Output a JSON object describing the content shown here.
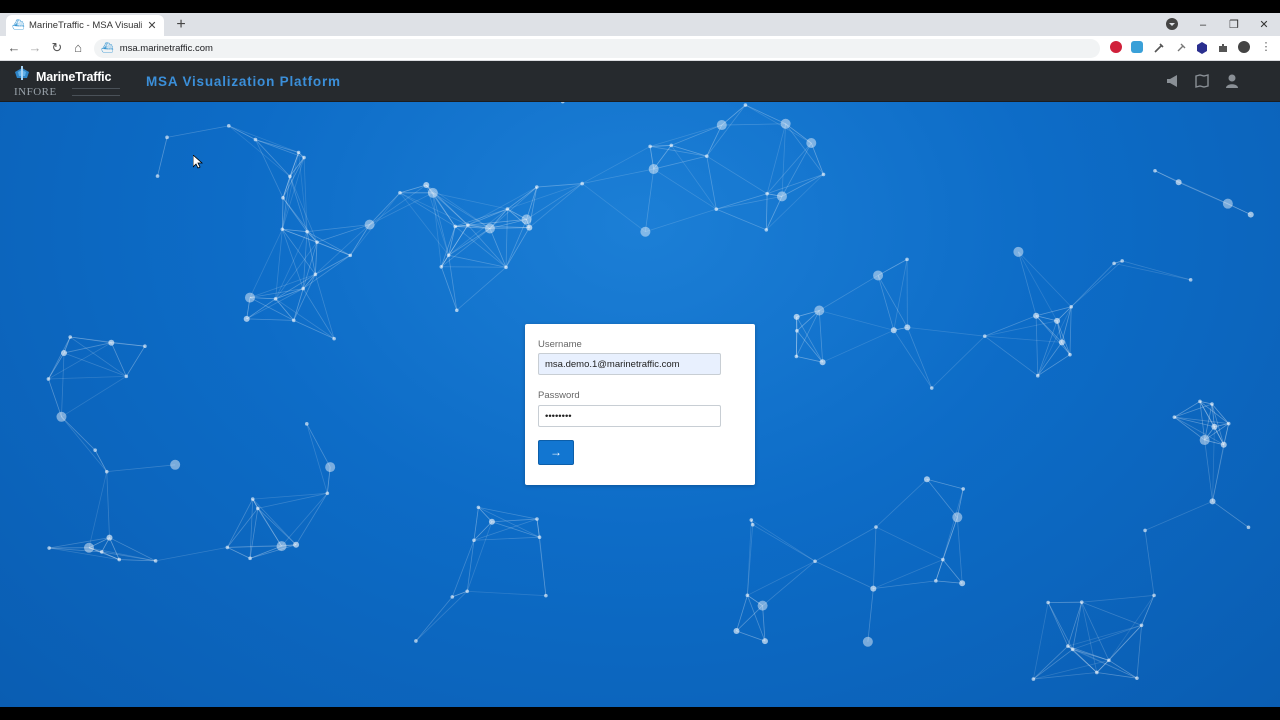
{
  "browser": {
    "tab": {
      "title": "MarineTraffic - MSA Visualization",
      "favicon": "marinetraffic-favicon"
    },
    "new_tab_label": "+",
    "nav": {
      "back": "←",
      "forward": "→",
      "reload": "↻",
      "home": "⌂"
    },
    "address": {
      "url": "msa.marinetraffic.com"
    },
    "window_controls": {
      "minimize": "–",
      "restore": "❐",
      "close": "✕"
    }
  },
  "header": {
    "logo_brand": "MarineTraffic",
    "logo_sub": "INFORE",
    "title": "MSA Visualization Platform",
    "icons": [
      "megaphone-icon",
      "map-book-icon",
      "user-icon"
    ],
    "title_color": "#3b8fd9",
    "background": "#262a2e"
  },
  "login": {
    "username_label": "Username",
    "username_value": "msa.demo.1@marinetraffic.com",
    "password_label": "Password",
    "password_value": "••••••••",
    "submit_label": "→",
    "accent": "#1276d1"
  },
  "background_theme": {
    "primary": "#0d6cc7",
    "network_color": "#ffffff"
  }
}
